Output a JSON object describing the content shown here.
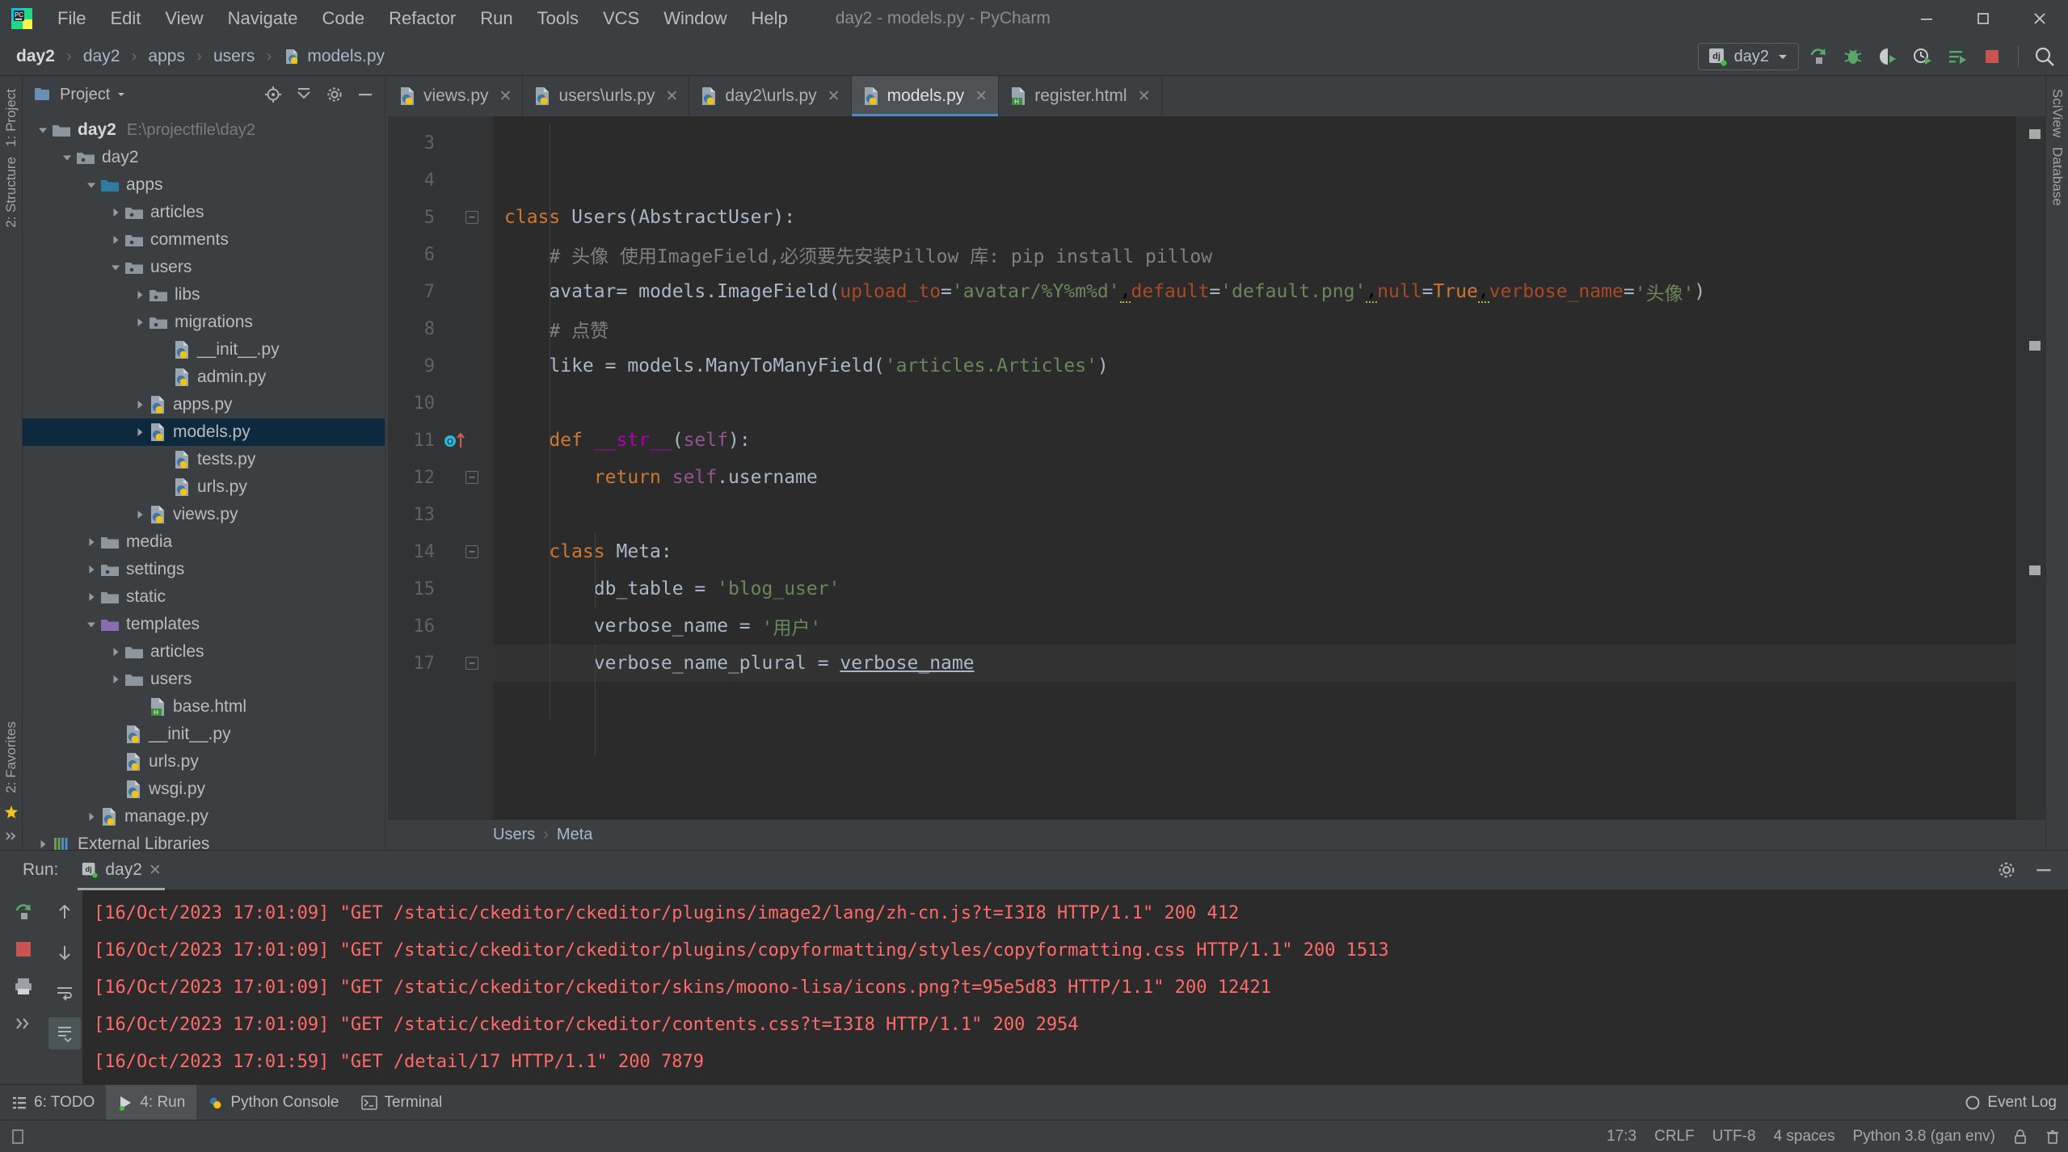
{
  "window": {
    "title": "day2 - models.py - PyCharm",
    "logo_icon": "pycharm-logo-icon",
    "minimize_icon": "minimize-icon",
    "maximize_icon": "maximize-icon",
    "close_icon": "close-icon"
  },
  "menu": {
    "items": [
      {
        "label": "File"
      },
      {
        "label": "Edit"
      },
      {
        "label": "View"
      },
      {
        "label": "Navigate"
      },
      {
        "label": "Code"
      },
      {
        "label": "Refactor"
      },
      {
        "label": "Run"
      },
      {
        "label": "Tools"
      },
      {
        "label": "VCS"
      },
      {
        "label": "Window"
      },
      {
        "label": "Help"
      }
    ]
  },
  "breadcrumb": {
    "items": [
      "day2",
      "day2",
      "apps",
      "users",
      "models.py"
    ],
    "separator": "›",
    "file_icon": "python-file-icon"
  },
  "toolbar_right": {
    "run_config": {
      "label": "day2",
      "icon": "django-config-icon",
      "dropdown_icon": "chevron-down-icon"
    },
    "buttons": [
      {
        "name": "run-button",
        "icon": "run-icon"
      },
      {
        "name": "debug-button",
        "icon": "debug-bug-icon"
      },
      {
        "name": "run-coverage-button",
        "icon": "coverage-icon"
      },
      {
        "name": "profile-button",
        "icon": "profiler-icon"
      },
      {
        "name": "run-with-params-button",
        "icon": "run-list-icon"
      },
      {
        "name": "stop-button",
        "icon": "stop-square-icon"
      },
      {
        "name": "search-everywhere-button",
        "icon": "search-icon"
      }
    ]
  },
  "left_strip": {
    "items": [
      "1: Project",
      "2: Structure"
    ],
    "bottom_items": [
      "2: Favorites"
    ],
    "expand_icon": "chevrons-right-icon"
  },
  "right_strip": {
    "items": [
      "SciView",
      "Database"
    ]
  },
  "project_panel": {
    "title": "Project",
    "title_dropdown_icon": "chevron-down-icon",
    "actions": [
      {
        "name": "locate-file-icon"
      },
      {
        "name": "collapse-all-icon"
      },
      {
        "name": "settings-gear-icon"
      },
      {
        "name": "hide-panel-icon"
      }
    ],
    "tree": [
      {
        "label": "day2",
        "path": "E:\\projectfile\\day2",
        "indent": 0,
        "arrow": "down",
        "icon": "folder-root",
        "bold": true,
        "selected": false
      },
      {
        "label": "day2",
        "path": "",
        "indent": 1,
        "arrow": "down",
        "icon": "folder-module",
        "bold": false,
        "selected": false
      },
      {
        "label": "apps",
        "path": "",
        "indent": 2,
        "arrow": "down",
        "icon": "folder-source",
        "bold": false,
        "selected": false
      },
      {
        "label": "articles",
        "path": "",
        "indent": 3,
        "arrow": "right",
        "icon": "folder-module",
        "bold": false,
        "selected": false
      },
      {
        "label": "comments",
        "path": "",
        "indent": 3,
        "arrow": "right",
        "icon": "folder-module",
        "bold": false,
        "selected": false
      },
      {
        "label": "users",
        "path": "",
        "indent": 3,
        "arrow": "down",
        "icon": "folder-module",
        "bold": false,
        "selected": false
      },
      {
        "label": "libs",
        "path": "",
        "indent": 4,
        "arrow": "right",
        "icon": "folder-module",
        "bold": false,
        "selected": false
      },
      {
        "label": "migrations",
        "path": "",
        "indent": 4,
        "arrow": "right",
        "icon": "folder-module",
        "bold": false,
        "selected": false
      },
      {
        "label": "__init__.py",
        "path": "",
        "indent": 5,
        "arrow": "none",
        "icon": "python-file",
        "bold": false,
        "selected": false
      },
      {
        "label": "admin.py",
        "path": "",
        "indent": 5,
        "arrow": "none",
        "icon": "python-file",
        "bold": false,
        "selected": false
      },
      {
        "label": "apps.py",
        "path": "",
        "indent": 4,
        "arrow": "right",
        "icon": "python-file",
        "bold": false,
        "selected": false
      },
      {
        "label": "models.py",
        "path": "",
        "indent": 4,
        "arrow": "right",
        "icon": "python-file",
        "bold": false,
        "selected": true
      },
      {
        "label": "tests.py",
        "path": "",
        "indent": 5,
        "arrow": "none",
        "icon": "python-file",
        "bold": false,
        "selected": false
      },
      {
        "label": "urls.py",
        "path": "",
        "indent": 5,
        "arrow": "none",
        "icon": "python-file",
        "bold": false,
        "selected": false
      },
      {
        "label": "views.py",
        "path": "",
        "indent": 4,
        "arrow": "right",
        "icon": "python-file",
        "bold": false,
        "selected": false
      },
      {
        "label": "media",
        "path": "",
        "indent": 2,
        "arrow": "right",
        "icon": "folder-plain",
        "bold": false,
        "selected": false
      },
      {
        "label": "settings",
        "path": "",
        "indent": 2,
        "arrow": "right",
        "icon": "folder-module",
        "bold": false,
        "selected": false
      },
      {
        "label": "static",
        "path": "",
        "indent": 2,
        "arrow": "right",
        "icon": "folder-plain",
        "bold": false,
        "selected": false
      },
      {
        "label": "templates",
        "path": "",
        "indent": 2,
        "arrow": "down",
        "icon": "folder-templates",
        "bold": false,
        "selected": false
      },
      {
        "label": "articles",
        "path": "",
        "indent": 3,
        "arrow": "right",
        "icon": "folder-plain",
        "bold": false,
        "selected": false
      },
      {
        "label": "users",
        "path": "",
        "indent": 3,
        "arrow": "right",
        "icon": "folder-plain",
        "bold": false,
        "selected": false
      },
      {
        "label": "base.html",
        "path": "",
        "indent": 4,
        "arrow": "none",
        "icon": "html-file",
        "bold": false,
        "selected": false
      },
      {
        "label": "__init__.py",
        "path": "",
        "indent": 3,
        "arrow": "none",
        "icon": "python-file",
        "bold": false,
        "selected": false
      },
      {
        "label": "urls.py",
        "path": "",
        "indent": 3,
        "arrow": "none",
        "icon": "python-file",
        "bold": false,
        "selected": false
      },
      {
        "label": "wsgi.py",
        "path": "",
        "indent": 3,
        "arrow": "none",
        "icon": "python-file",
        "bold": false,
        "selected": false
      },
      {
        "label": "manage.py",
        "path": "",
        "indent": 2,
        "arrow": "right",
        "icon": "python-file",
        "bold": false,
        "selected": false
      },
      {
        "label": "External Libraries",
        "path": "",
        "indent": 0,
        "arrow": "right",
        "icon": "libraries",
        "bold": false,
        "selected": false
      }
    ]
  },
  "editor": {
    "tabs": [
      {
        "label": "views.py",
        "icon": "python-file-icon",
        "active": false,
        "close_icon": "close-icon"
      },
      {
        "label": "users\\urls.py",
        "icon": "python-file-icon",
        "active": false,
        "close_icon": "close-icon"
      },
      {
        "label": "day2\\urls.py",
        "icon": "python-file-icon",
        "active": false,
        "close_icon": "close-icon"
      },
      {
        "label": "models.py",
        "icon": "python-file-icon",
        "active": true,
        "close_icon": "close-icon"
      },
      {
        "label": "register.html",
        "icon": "html-file-icon",
        "active": false,
        "close_icon": "close-icon"
      }
    ],
    "first_visible_line": 3,
    "lines": [
      {
        "num": 3,
        "fold": "none",
        "gutter_icon": "none",
        "current": false,
        "tokens": []
      },
      {
        "num": 4,
        "fold": "none",
        "gutter_icon": "none",
        "current": false,
        "tokens": []
      },
      {
        "num": 5,
        "fold": "open",
        "gutter_icon": "none",
        "current": false,
        "tokens": [
          {
            "t": "class ",
            "c": "kw"
          },
          {
            "t": "Users",
            "c": "cls"
          },
          {
            "t": "(AbstractUser):",
            "c": "id"
          }
        ]
      },
      {
        "num": 6,
        "fold": "none",
        "gutter_icon": "none",
        "current": false,
        "tokens": [
          {
            "t": "    # 头像 使用ImageField,必须要先安装Pillow 库: pip install pillow",
            "c": "com"
          }
        ]
      },
      {
        "num": 7,
        "fold": "none",
        "gutter_icon": "none",
        "current": false,
        "tokens": [
          {
            "t": "    avatar= models.ImageField(",
            "c": "id"
          },
          {
            "t": "upload_to",
            "c": "param"
          },
          {
            "t": "=",
            "c": "id"
          },
          {
            "t": "'avatar/%Y%m%d'",
            "c": "str"
          },
          {
            "t": ",",
            "c": "warn"
          },
          {
            "t": "default",
            "c": "param"
          },
          {
            "t": "=",
            "c": "id"
          },
          {
            "t": "'default.png'",
            "c": "str"
          },
          {
            "t": ",",
            "c": "warn"
          },
          {
            "t": "null",
            "c": "param"
          },
          {
            "t": "=",
            "c": "id"
          },
          {
            "t": "True",
            "c": "kw"
          },
          {
            "t": ",",
            "c": "warn"
          },
          {
            "t": "verbose_name",
            "c": "param"
          },
          {
            "t": "=",
            "c": "id"
          },
          {
            "t": "'头像'",
            "c": "str"
          },
          {
            "t": ")",
            "c": "id"
          }
        ]
      },
      {
        "num": 8,
        "fold": "none",
        "gutter_icon": "none",
        "current": false,
        "tokens": [
          {
            "t": "    # 点赞",
            "c": "com"
          }
        ]
      },
      {
        "num": 9,
        "fold": "none",
        "gutter_icon": "none",
        "current": false,
        "tokens": [
          {
            "t": "    like = models.ManyToManyField(",
            "c": "id"
          },
          {
            "t": "'articles.Articles'",
            "c": "str"
          },
          {
            "t": ")",
            "c": "id"
          }
        ]
      },
      {
        "num": 10,
        "fold": "none",
        "gutter_icon": "none",
        "current": false,
        "tokens": []
      },
      {
        "num": 11,
        "fold": "open",
        "gutter_icon": "override-method",
        "current": false,
        "tokens": [
          {
            "t": "    ",
            "c": "id"
          },
          {
            "t": "def ",
            "c": "kw"
          },
          {
            "t": "__str__",
            "c": "magic"
          },
          {
            "t": "(",
            "c": "id"
          },
          {
            "t": "self",
            "c": "self"
          },
          {
            "t": "):",
            "c": "id"
          }
        ]
      },
      {
        "num": 12,
        "fold": "end",
        "gutter_icon": "none",
        "current": false,
        "tokens": [
          {
            "t": "        ",
            "c": "id"
          },
          {
            "t": "return ",
            "c": "kw"
          },
          {
            "t": "self",
            "c": "self"
          },
          {
            "t": ".username",
            "c": "id"
          }
        ]
      },
      {
        "num": 13,
        "fold": "none",
        "gutter_icon": "none",
        "current": false,
        "tokens": []
      },
      {
        "num": 14,
        "fold": "open",
        "gutter_icon": "none",
        "current": false,
        "tokens": [
          {
            "t": "    ",
            "c": "id"
          },
          {
            "t": "class ",
            "c": "kw"
          },
          {
            "t": "Meta",
            "c": "cls"
          },
          {
            "t": ":",
            "c": "id"
          }
        ]
      },
      {
        "num": 15,
        "fold": "none",
        "gutter_icon": "none",
        "current": false,
        "tokens": [
          {
            "t": "        db_table = ",
            "c": "id"
          },
          {
            "t": "'blog_user'",
            "c": "str"
          }
        ]
      },
      {
        "num": 16,
        "fold": "none",
        "gutter_icon": "none",
        "current": false,
        "tokens": [
          {
            "t": "        verbose_name = ",
            "c": "id"
          },
          {
            "t": "'用户'",
            "c": "str"
          }
        ]
      },
      {
        "num": 17,
        "fold": "end",
        "gutter_icon": "none",
        "current": true,
        "tokens": [
          {
            "t": "        verbose_name_plural = ",
            "c": "id"
          },
          {
            "t": "verbose_name",
            "c": "underline"
          }
        ]
      }
    ],
    "structure_crumb": [
      "Users",
      "Meta"
    ],
    "structure_sep": "›"
  },
  "run_panel": {
    "label": "Run:",
    "tab": {
      "label": "day2",
      "icon": "django-run-icon",
      "close_icon": "close-icon"
    },
    "header_actions": [
      {
        "name": "settings-gear-icon"
      },
      {
        "name": "hide-panel-icon"
      }
    ],
    "tools": [
      {
        "name": "rerun-button",
        "icon": "rerun-icon"
      },
      {
        "name": "stop-button",
        "icon": "stop-square-icon"
      },
      {
        "name": "print-button",
        "icon": "print-icon"
      },
      {
        "name": "expand-button",
        "icon": "chevrons-right-icon"
      }
    ],
    "tools2": [
      {
        "name": "scroll-up-button",
        "icon": "arrow-up-icon"
      },
      {
        "name": "scroll-down-button",
        "icon": "arrow-down-icon"
      },
      {
        "name": "soft-wrap-button",
        "icon": "wrap-icon"
      },
      {
        "name": "scroll-to-end-button",
        "icon": "scroll-end-icon"
      }
    ],
    "console_lines": [
      "[16/Oct/2023 17:01:09] \"GET /static/ckeditor/ckeditor/plugins/image2/lang/zh-cn.js?t=I3I8 HTTP/1.1\" 200 412",
      "[16/Oct/2023 17:01:09] \"GET /static/ckeditor/ckeditor/plugins/copyformatting/styles/copyformatting.css HTTP/1.1\" 200 1513",
      "[16/Oct/2023 17:01:09] \"GET /static/ckeditor/ckeditor/skins/moono-lisa/icons.png?t=95e5d83 HTTP/1.1\" 200 12421",
      "[16/Oct/2023 17:01:09] \"GET /static/ckeditor/ckeditor/contents.css?t=I3I8 HTTP/1.1\" 200 2954",
      "[16/Oct/2023 17:01:59] \"GET /detail/17 HTTP/1.1\" 200 7879"
    ]
  },
  "bottom_tabs": {
    "items": [
      {
        "label": "6: TODO",
        "icon": "todo-icon",
        "active": false
      },
      {
        "label": "4: Run",
        "icon": "run-triangle-icon",
        "active": true
      },
      {
        "label": "Python Console",
        "icon": "python-console-icon",
        "active": false
      },
      {
        "label": "Terminal",
        "icon": "terminal-icon",
        "active": false
      }
    ],
    "event_log": {
      "label": "Event Log",
      "icon": "event-log-icon"
    }
  },
  "status_bar": {
    "left_icon": "memory-indicator-icon",
    "items": [
      "17:3",
      "CRLF",
      "UTF-8",
      "4 spaces",
      "Python 3.8 (gan env)"
    ],
    "lock_icon": "lock-icon",
    "trash_icon": "trash-icon"
  },
  "colors": {
    "chrome": "#3c3f41",
    "editor_bg": "#2b2b2b",
    "gutter_bg": "#313335",
    "selection": "#0d293e",
    "accent_blue": "#4a88c7",
    "console_red": "#ff6b68",
    "keyword_orange": "#cc7832",
    "string_green": "#6a8759",
    "param_rust": "#aa4926",
    "self_purple": "#94558d",
    "comment_gray": "#808080"
  }
}
